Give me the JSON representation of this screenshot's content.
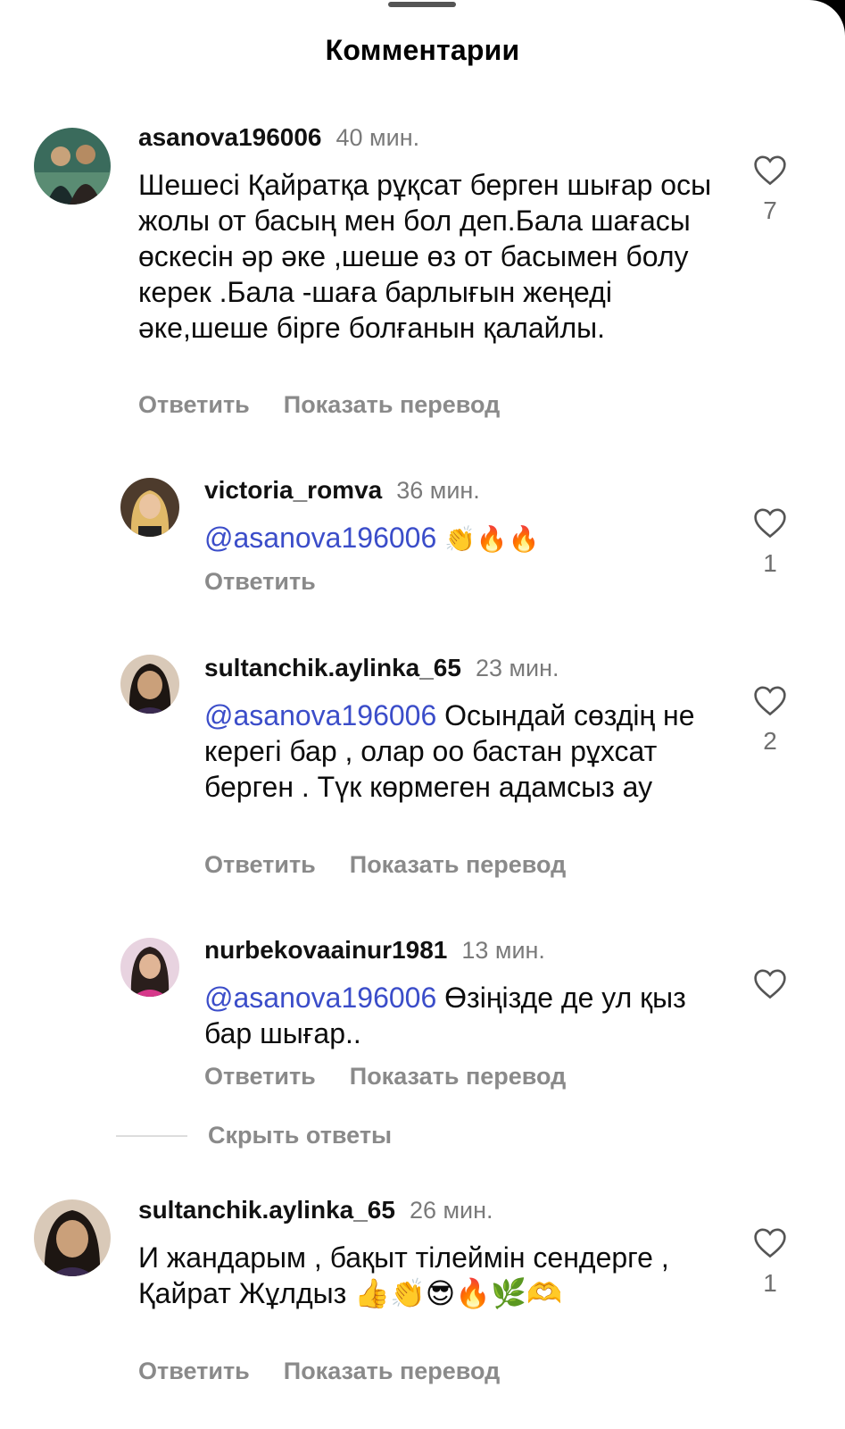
{
  "header": {
    "title": "Комментарии"
  },
  "labels": {
    "reply": "Ответить",
    "translate": "Показать перевод",
    "hide_replies": "Скрыть ответы"
  },
  "comments": [
    {
      "username": "asanova196006",
      "time": "40 мин.",
      "text": "Шешесі Қайратқа рұқсат берген шығар осы жолы от басың мен бол деп.Бала шағасы өскесін әр әке ,шеше өз от басымен болу керек .Бала -шаға барлығын жеңеді әке,шеше бірге болғанын қалайлы.",
      "likes": "7"
    },
    {
      "username": "victoria_romva",
      "time": "36 мин.",
      "mention": "@asanova196006",
      "text": " 👏🔥🔥",
      "likes": "1"
    },
    {
      "username": "sultanchik.aylinka_65",
      "time": "23 мин.",
      "mention": "@asanova196006",
      "text": " Осындай сөздің не керегі бар , олар оо бастан рұхсат берген . Түк көрмеген адамсыз ау",
      "likes": "2"
    },
    {
      "username": "nurbekovaainur1981",
      "time": "13 мин.",
      "mention": "@asanova196006",
      "text": " Өзіңізде де ул қыз бар шығар..",
      "likes": ""
    },
    {
      "username": "sultanchik.aylinka_65",
      "time": "26 мин.",
      "text": "И жандарым , бақыт тілеймін сендерге , Қайрат Жұлдыз 👍👏😎🔥🌿🫶",
      "likes": "1"
    }
  ]
}
